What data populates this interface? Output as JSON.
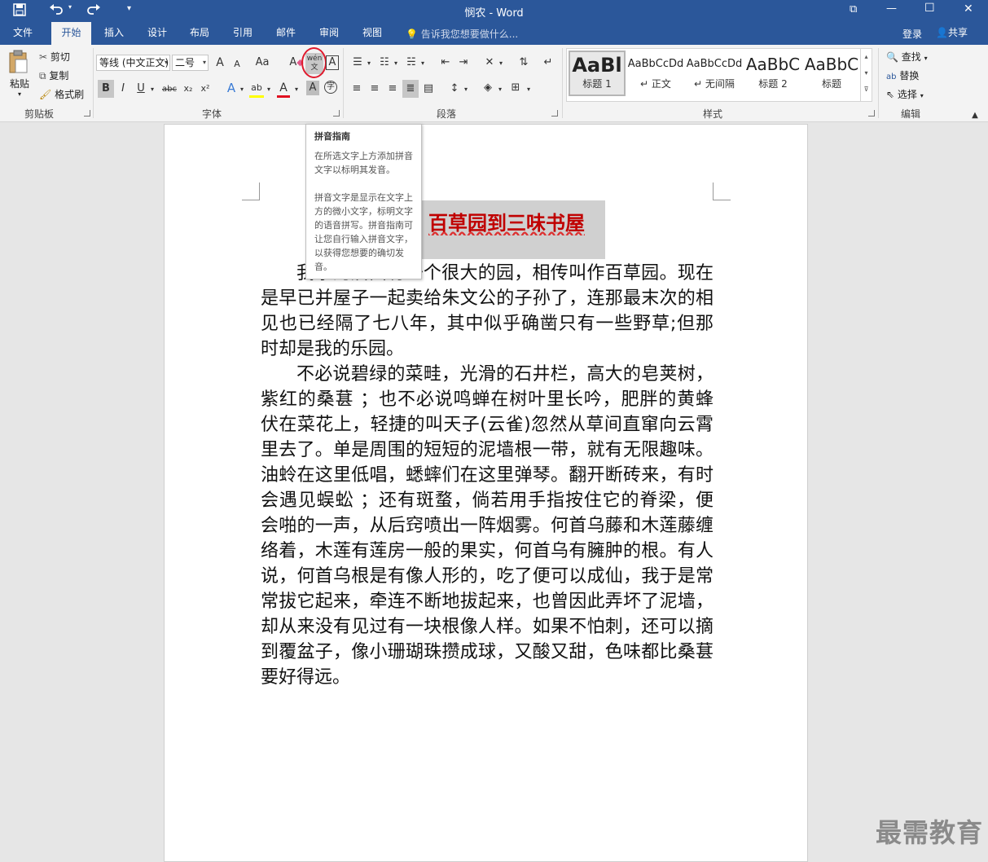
{
  "window": {
    "title": "悯农 - Word"
  },
  "quick_access": {
    "save_icon": "save-icon",
    "undo_icon": "undo-icon",
    "redo_icon": "redo-icon",
    "customize": "▾"
  },
  "window_controls": {
    "ribbon_display": "⧉",
    "minimize": "—",
    "maximize": "☐",
    "close": "✕"
  },
  "tabs": [
    {
      "label": "文件"
    },
    {
      "label": "开始"
    },
    {
      "label": "插入"
    },
    {
      "label": "设计"
    },
    {
      "label": "布局"
    },
    {
      "label": "引用"
    },
    {
      "label": "邮件"
    },
    {
      "label": "审阅"
    },
    {
      "label": "视图"
    }
  ],
  "tell_me": {
    "placeholder": "告诉我您想要做什么..."
  },
  "account": {
    "login": "登录",
    "share": "共享"
  },
  "clipboard": {
    "paste": "粘贴",
    "cut": "剪切",
    "copy": "复制",
    "format_painter": "格式刷",
    "group": "剪贴板"
  },
  "font": {
    "name": "等线 (中文正文)",
    "size": "二号",
    "group": "字体",
    "grow": "A",
    "shrink": "A",
    "change_case": "Aa",
    "clear": "A",
    "phonetic": "wén 文",
    "border": "A",
    "bold": "B",
    "italic": "I",
    "underline": "U",
    "strike": "abc",
    "sub": "x₂",
    "sup": "x²",
    "text_effect": "A",
    "highlight": "ab",
    "font_color": "A",
    "shading": "A",
    "enclose": "字"
  },
  "paragraph": {
    "group": "段落"
  },
  "styles": {
    "group": "样式",
    "items": [
      {
        "preview": "AaBl",
        "name": "标题 1"
      },
      {
        "preview": "AaBbCcDd",
        "name": "正文"
      },
      {
        "preview": "AaBbCcDd",
        "name": "无间隔"
      },
      {
        "preview": "AaBbC",
        "name": "标题 2"
      },
      {
        "preview": "AaBbC",
        "name": "标题"
      }
    ]
  },
  "editing": {
    "find": "查找",
    "replace": "替换",
    "select": "选择",
    "group": "编辑"
  },
  "tooltip": {
    "title": "拼音指南",
    "desc1": "在所选文字上方添加拼音文字以标明其发音。",
    "desc2": "拼音文字是显示在文字上方的微小文字，标明文字的语音拼写。拼音指南可让您自行输入拼音文字，以获得您想要的确切发音。"
  },
  "document": {
    "title_visible": "百草园到三味书屋",
    "p1_start": "我家的后面有一个很大的园，相传叫作百草园。现在是早已并屋子一起卖给朱文公的子孙了，连那最末次的相见也已经隔了七八年，其中似乎确凿只有一些野草;但那时却是我的乐园。",
    "p2": "不必说碧绿的菜畦，光滑的石井栏，高大的皂荚树，紫红的桑葚 ；也不必说鸣蝉在树叶里长吟，肥胖的黄蜂伏在菜花上，轻捷的叫天子(云雀)忽然从草间直窜向云霄里去了。单是周围的短短的泥墙根一带，就有无限趣味。油蛉在这里低唱，蟋蟀们在这里弹琴。翻开断砖来，有时会遇见蜈蚣 ；还有斑蝥，倘若用手指按住它的脊梁，便会啪的一声，从后窍喷出一阵烟雾。何首乌藤和木莲藤缠络着，木莲有莲房一般的果实，何首乌有臃肿的根。有人说，何首乌根是有像人形的，吃了便可以成仙，我于是常常拔它起来，牵连不断地拔起来，也曾因此弄坏了泥墙，却从来没有见过有一块根像人样。如果不怕刺，还可以摘到覆盆子，像小珊瑚珠攒成球，又酸又甜，色味都比桑葚要好得远。"
  },
  "watermark": "最需教育",
  "colors": {
    "accent": "#2b579a",
    "title_red": "#c00000",
    "ribbon_bg": "#f3f3f3",
    "highlight_circle": "#e0192c"
  }
}
